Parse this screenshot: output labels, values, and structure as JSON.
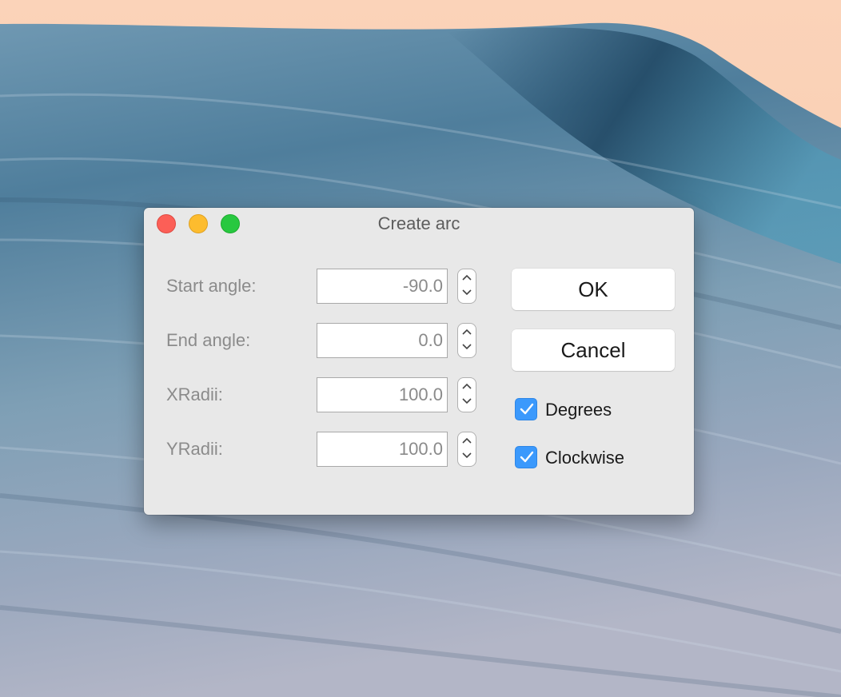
{
  "window": {
    "title": "Create arc"
  },
  "fields": [
    {
      "label": "Start angle:",
      "value": "-90.0"
    },
    {
      "label": "End angle:",
      "value": "0.0"
    },
    {
      "label": "XRadii:",
      "value": "100.0"
    },
    {
      "label": "YRadii:",
      "value": "100.0"
    }
  ],
  "buttons": {
    "ok": "OK",
    "cancel": "Cancel"
  },
  "options": {
    "degrees": {
      "label": "Degrees",
      "checked": true
    },
    "clockwise": {
      "label": "Clockwise",
      "checked": true
    }
  },
  "colors": {
    "accent": "#3b99fc",
    "close": "#fc5f57",
    "minimize": "#fdbc2e",
    "zoom": "#28c840"
  },
  "icons": {
    "stepper": "chevron-up-down-icon",
    "check": "checkmark-icon"
  }
}
